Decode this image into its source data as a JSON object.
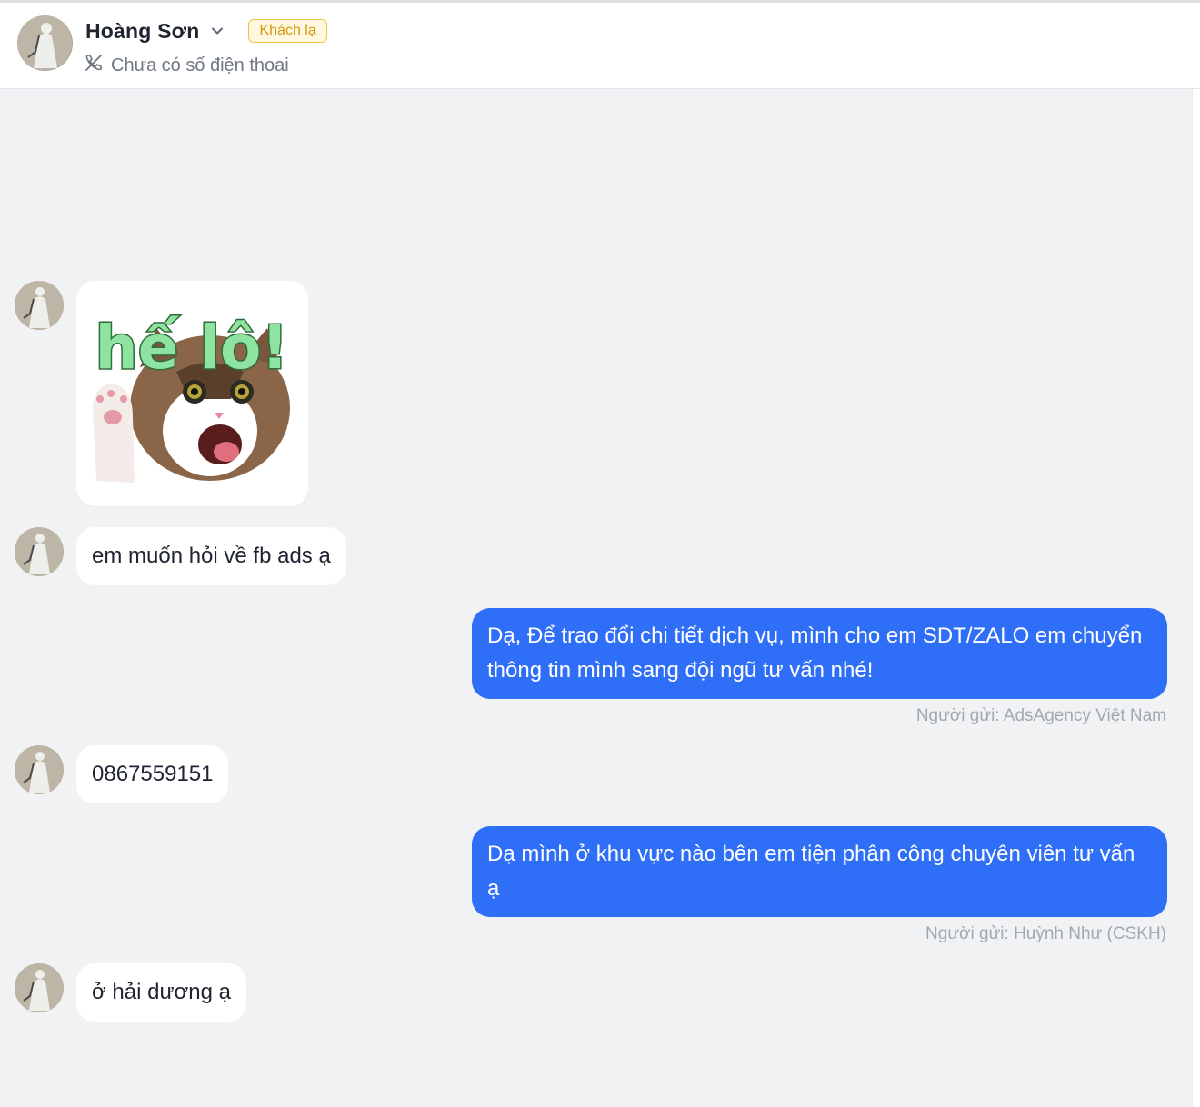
{
  "header": {
    "contact_name": "Hoàng Sơn",
    "badge": "Khách lạ",
    "phone_status": "Chưa có số điện thoai",
    "icons": {
      "avatar": "user-avatar",
      "dropdown": "chevron-down-icon",
      "phone": "phone-off-icon"
    }
  },
  "sticker": {
    "text": "hế lô!",
    "description_icon": "cat-waving-sticker"
  },
  "messages": [
    {
      "direction": "in",
      "text": "em muốn hỏi về fb ads ạ"
    },
    {
      "direction": "out",
      "text": "Dạ, Để trao đổi chi tiết dịch vụ, mình cho em SDT/ZALO em chuyển thông tin mình sang đội ngũ tư vấn nhé!",
      "sender": "Người gửi: AdsAgency Việt Nam"
    },
    {
      "direction": "in",
      "text": "0867559151"
    },
    {
      "direction": "out",
      "text": "Dạ mình ở khu vực nào bên em tiện phân công chuyên viên tư vấn ạ",
      "sender": "Người gửi: Huỳnh Như (CSKH)"
    },
    {
      "direction": "in",
      "text": "ở hải dương ạ"
    }
  ],
  "colors": {
    "outgoing_bubble": "#2f6ef6",
    "incoming_bubble": "#ffffff",
    "chat_background": "#f1f2f4",
    "badge_border": "#f0c34a",
    "badge_text": "#d39a08"
  }
}
